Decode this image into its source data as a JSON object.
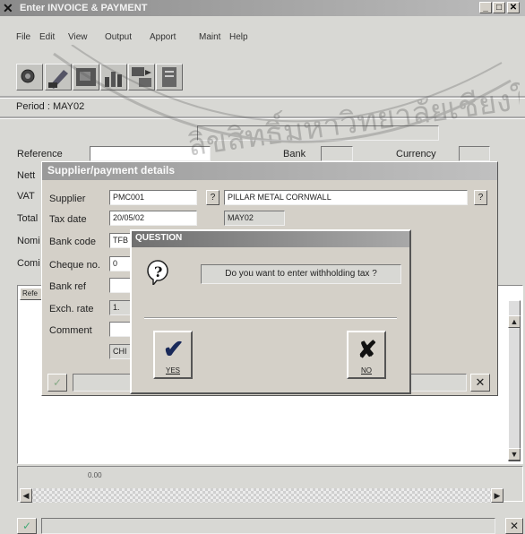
{
  "window": {
    "title": "Enter INVOICE & PAYMENT",
    "controls": [
      "_",
      "□",
      "x"
    ]
  },
  "menu": [
    "File",
    "Edit",
    "View",
    "Output",
    "Apport",
    "Maint",
    "Help"
  ],
  "toolbar": [
    "search-icon",
    "edit-icon",
    "image-icon",
    "chart-icon",
    "transfer-icon",
    "document-icon"
  ],
  "period": "Period : MAY02",
  "main_form": {
    "reference_label": "Reference",
    "bank_label": "Bank",
    "currency_label": "Currency",
    "nett_label": "Nett",
    "vat_label": "VAT",
    "total_label": "Total",
    "nomi_label": "Nomi",
    "comi_label": "Comi",
    "list_header": "Refe",
    "amount": "0.00"
  },
  "supplier_dialog": {
    "title": "Supplier/payment details",
    "supplier_label": "Supplier",
    "supplier_code": "PMC001",
    "supplier_name": "PILLAR METAL CORNWALL",
    "lookup": "?",
    "tax_date_label": "Tax date",
    "tax_date": "20/05/02",
    "tax_period": "MAY02",
    "bank_code_label": "Bank code",
    "bank_code": "TFB",
    "cheque_label": "Cheque no.",
    "cheque_no": "0",
    "bank_ref_label": "Bank ref",
    "exch_label": "Exch. rate",
    "exch_rate": "1.",
    "comment_label": "Comment",
    "chq_value": "CHI"
  },
  "question_dialog": {
    "title": "QUESTION",
    "message": "Do you want to enter withholding tax ?",
    "icon": "?",
    "yes_label": "YES",
    "no_label": "NO"
  },
  "watermark": "ลิขสิทธิ์มหาวิทยาลัยเชียงใหม่"
}
